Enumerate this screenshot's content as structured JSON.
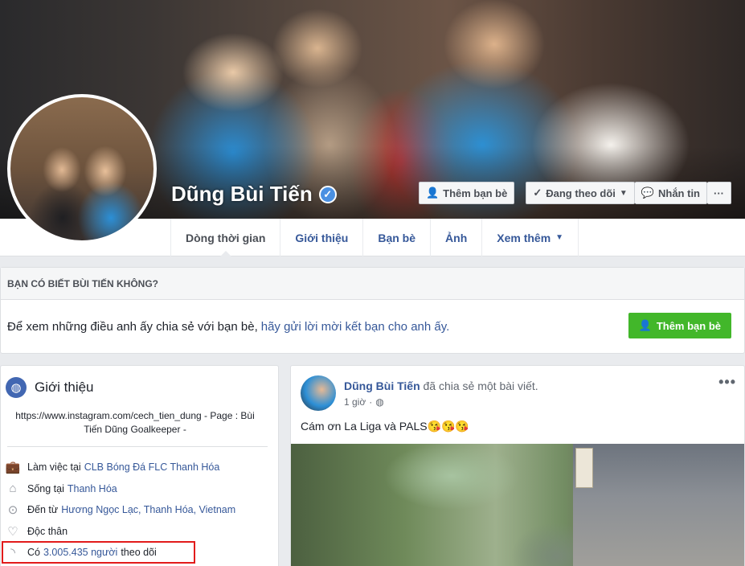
{
  "profile": {
    "name": "Dũng Bùi Tiến",
    "verified_icon": "verified-badge-icon"
  },
  "cover_actions": {
    "add_friend": "Thêm bạn bè",
    "following": "Đang theo dõi",
    "message": "Nhắn tin",
    "more": "···"
  },
  "tabs": [
    {
      "label": "Dòng thời gian"
    },
    {
      "label": "Giới thiệu"
    },
    {
      "label": "Bạn bè"
    },
    {
      "label": "Ảnh"
    },
    {
      "label": "Xem thêm"
    }
  ],
  "know_card": {
    "heading": "BẠN CÓ BIẾT BÙI TIẾN KHÔNG?",
    "text": "Để xem những điều anh ấy chia sẻ với bạn bè,",
    "link": "hãy gửi lời mời kết bạn cho anh ấy.",
    "button": "Thêm bạn bè"
  },
  "intro": {
    "title": "Giới thiệu",
    "bio": "https://www.instagram.com/cech_tien_dung - Page : Bùi Tiến Dũng Goalkeeper -",
    "rows": [
      {
        "icon": "briefcase-icon",
        "prefix": "Làm việc tại",
        "link": "CLB Bóng Đá FLC Thanh Hóa",
        "suffix": ""
      },
      {
        "icon": "home-icon",
        "prefix": "Sống tại",
        "link": "Thanh Hóa",
        "suffix": ""
      },
      {
        "icon": "location-pin-icon",
        "prefix": "Đến từ",
        "link": "Hương Ngọc Lạc, Thanh Hóa, Vietnam",
        "suffix": ""
      },
      {
        "icon": "heart-icon",
        "prefix": "Độc thân",
        "link": "",
        "suffix": ""
      },
      {
        "icon": "rss-icon",
        "prefix": "Có",
        "link": "3.005.435 người",
        "suffix": "theo dõi"
      }
    ]
  },
  "post": {
    "author": "Dũng Bùi Tiến",
    "action": "đã chia sẻ một bài viết.",
    "time": "1 giờ",
    "text": "Cám ơn La Liga và PALS😘😘😘"
  },
  "colors": {
    "link": "#365899",
    "green": "#42b72a",
    "highlight": "#e21b1b"
  }
}
